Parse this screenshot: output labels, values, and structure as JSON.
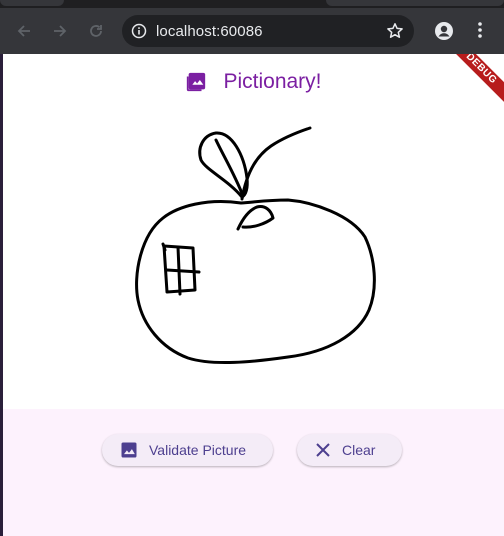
{
  "browser": {
    "url": "localhost:60086",
    "icons": {
      "back": "arrow-left-icon",
      "forward": "arrow-right-icon",
      "reload": "reload-icon",
      "info": "site-info-icon",
      "bookmark": "star-icon",
      "profile": "profile-icon",
      "menu": "more-vert-icon"
    }
  },
  "app": {
    "title": "Pictionary!",
    "title_icon": "image-icon",
    "debug_banner": "DEBUG",
    "accent_color": "#7b1fa2",
    "buttons": {
      "validate": {
        "label": "Validate Picture",
        "icon": "image-icon"
      },
      "clear": {
        "label": "Clear",
        "icon": "close-icon"
      }
    }
  },
  "canvas": {
    "drawing": "apple-sketch"
  }
}
